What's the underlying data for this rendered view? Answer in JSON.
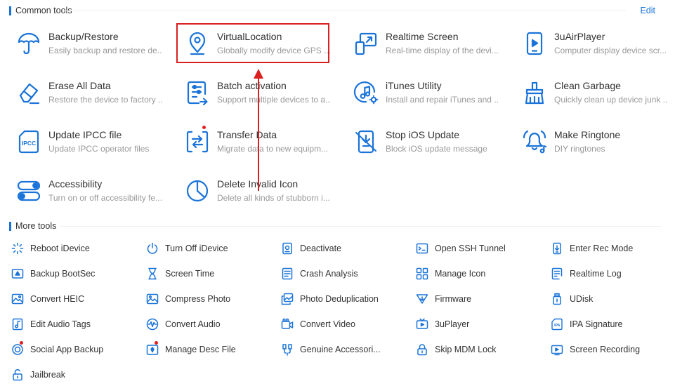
{
  "common": {
    "title": "Common tools",
    "edit": "Edit",
    "tools": [
      {
        "name": "Backup/Restore",
        "desc": "Easily backup and restore de...",
        "icon": "umbrella-icon"
      },
      {
        "name": "VirtualLocation",
        "desc": "Globally modify device GPS ...",
        "icon": "location-pin-icon"
      },
      {
        "name": "Realtime Screen",
        "desc": "Real-time display of the devi...",
        "icon": "realtime-screen-icon"
      },
      {
        "name": "3uAirPlayer",
        "desc": "Computer display device scr...",
        "icon": "airplayer-icon"
      },
      {
        "name": "Erase All Data",
        "desc": "Restore the device to factory ...",
        "icon": "eraser-icon"
      },
      {
        "name": "Batch activation",
        "desc": "Support multiple devices to a...",
        "icon": "batch-activation-icon"
      },
      {
        "name": "iTunes Utility",
        "desc": "Install and repair iTunes and ...",
        "icon": "itunes-icon"
      },
      {
        "name": "Clean Garbage",
        "desc": "Quickly clean up device junk ...",
        "icon": "broom-icon"
      },
      {
        "name": "Update IPCC file",
        "desc": "Update IPCC operator files",
        "icon": "ipcc-icon",
        "icon_text": "IPCC"
      },
      {
        "name": "Transfer Data",
        "desc": "Migrate data to new equipm...",
        "icon": "transfer-icon"
      },
      {
        "name": "Stop iOS Update",
        "desc": "Block iOS update message",
        "icon": "stop-update-icon"
      },
      {
        "name": "Make Ringtone",
        "desc": "DIY ringtones",
        "icon": "bell-icon"
      },
      {
        "name": "Accessibility",
        "desc": "Turn on or off accessibility fe...",
        "icon": "toggle-icon"
      },
      {
        "name": "Delete Invalid Icon",
        "desc": "Delete all kinds of stubborn i...",
        "icon": "pie-clock-icon"
      }
    ]
  },
  "more": {
    "title": "More tools",
    "tools": [
      {
        "label": "Reboot iDevice",
        "icon": "reboot-icon"
      },
      {
        "label": "Turn Off iDevice",
        "icon": "power-icon"
      },
      {
        "label": "Deactivate",
        "icon": "deactivate-icon"
      },
      {
        "label": "Open SSH Tunnel",
        "icon": "terminal-icon"
      },
      {
        "label": "Enter Rec Mode",
        "icon": "rec-mode-icon"
      },
      {
        "label": "Backup BootSec",
        "icon": "backup-bootsec-icon"
      },
      {
        "label": "Screen Time",
        "icon": "hourglass-icon"
      },
      {
        "label": "Crash Analysis",
        "icon": "crash-analysis-icon"
      },
      {
        "label": "Manage Icon",
        "icon": "grid-icon"
      },
      {
        "label": "Realtime Log",
        "icon": "log-icon"
      },
      {
        "label": "Convert HEIC",
        "icon": "image-icon"
      },
      {
        "label": "Compress Photo",
        "icon": "photo-icon"
      },
      {
        "label": "Photo Deduplication",
        "icon": "photo-dedup-icon"
      },
      {
        "label": "Firmware",
        "icon": "firmware-icon"
      },
      {
        "label": "UDisk",
        "icon": "udisk-icon"
      },
      {
        "label": "Edit Audio Tags",
        "icon": "audio-tag-icon"
      },
      {
        "label": "Convert Audio",
        "icon": "waveform-icon"
      },
      {
        "label": "Convert Video",
        "icon": "video-icon"
      },
      {
        "label": "3uPlayer",
        "icon": "tv-icon"
      },
      {
        "label": "IPA Signature",
        "icon": "ipa-icon",
        "icon_text": "IPA"
      },
      {
        "label": "Social App Backup",
        "icon": "social-backup-icon"
      },
      {
        "label": "Manage Desc File",
        "icon": "desc-file-icon"
      },
      {
        "label": "Genuine Accessori...",
        "icon": "accessories-icon"
      },
      {
        "label": "Skip MDM Lock",
        "icon": "lock-icon"
      },
      {
        "label": "Screen Recording",
        "icon": "screen-record-icon"
      },
      {
        "label": "Jailbreak",
        "icon": "jailbreak-icon"
      }
    ]
  },
  "colors": {
    "accent": "#1a73d9",
    "highlight": "#d9201f",
    "badge": "#e02020"
  }
}
